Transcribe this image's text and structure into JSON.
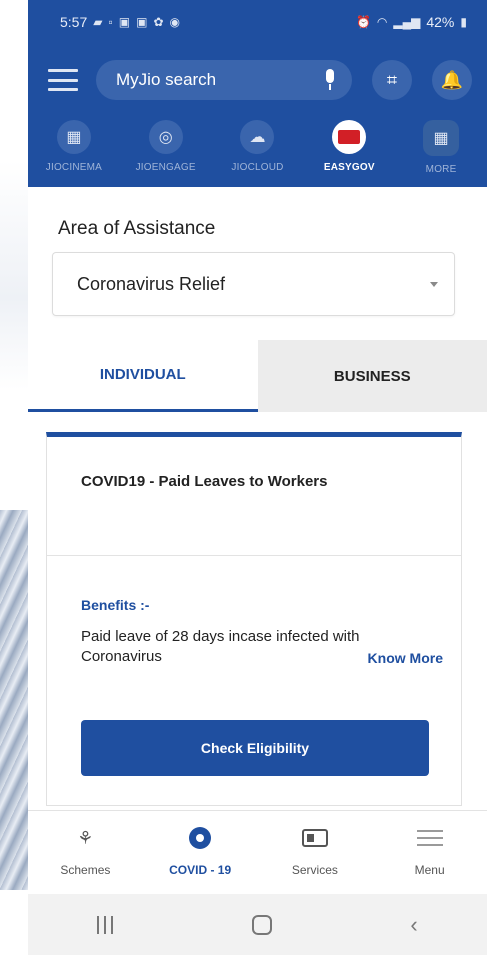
{
  "status_bar": {
    "time": "5:57",
    "battery": "42%"
  },
  "search": {
    "placeholder": "MyJio search"
  },
  "app_strip": [
    {
      "label": "JIOCINEMA",
      "icon": "clapper-icon"
    },
    {
      "label": "JIOENGAGE",
      "icon": "engage-icon"
    },
    {
      "label": "JIOCLOUD",
      "icon": "cloud-icon"
    },
    {
      "label": "EASYGOV",
      "icon": "easygov-icon",
      "active": true
    },
    {
      "label": "MORE",
      "icon": "grid-icon"
    }
  ],
  "area": {
    "label": "Area of Assistance",
    "selected": "Coronavirus Relief"
  },
  "tabs": [
    {
      "label": "INDIVIDUAL",
      "active": true
    },
    {
      "label": "BUSINESS",
      "active": false
    }
  ],
  "card": {
    "title": "COVID19 - Paid Leaves to Workers",
    "benefits_label": "Benefits :-",
    "benefits_text": "Paid leave of 28 days incase infected with Coronavirus",
    "know_more": "Know More",
    "check_button": "Check Eligibility"
  },
  "bottom_nav": [
    {
      "label": "Schemes"
    },
    {
      "label": "COVID - 19",
      "active": true
    },
    {
      "label": "Services"
    },
    {
      "label": "Menu"
    }
  ],
  "colors": {
    "primary": "#1f4fa0",
    "header": "#1f4fa0",
    "tab_inactive_bg": "#ececec"
  }
}
